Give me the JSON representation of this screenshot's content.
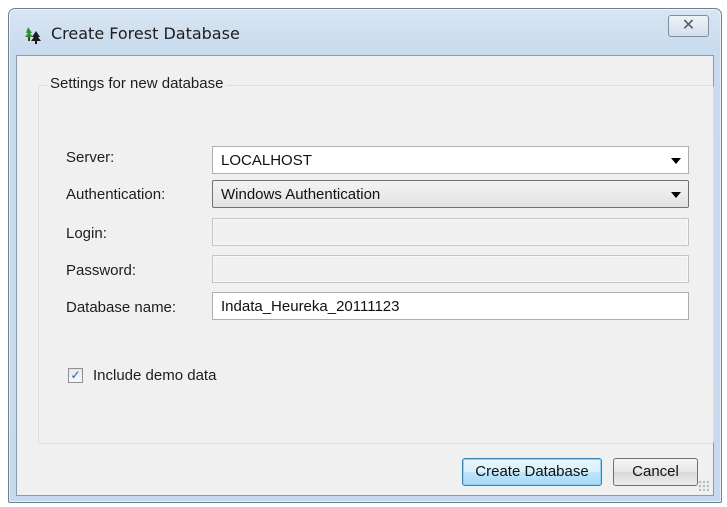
{
  "window": {
    "title": "Create Forest Database",
    "icon": "forest-tree-icon",
    "close_glyph": "✕"
  },
  "group": {
    "title": "Settings for new database"
  },
  "fields": {
    "server_label": "Server:",
    "server_value": "LOCALHOST",
    "authentication_label": "Authentication:",
    "authentication_value": "Windows Authentication",
    "login_label": "Login:",
    "login_value": "",
    "password_label": "Password:",
    "password_value": "",
    "database_name_label": "Database name:",
    "database_name_value": "Indata_Heureka_20111123"
  },
  "options": {
    "include_demo_label": "Include demo data",
    "include_demo_checked": true,
    "check_glyph": "✓"
  },
  "buttons": {
    "create": "Create Database",
    "cancel": "Cancel"
  },
  "colors": {
    "title_bar": "#c9dbee",
    "client_background": "#f0f0f0",
    "default_button_border": "#3c7fb1"
  }
}
